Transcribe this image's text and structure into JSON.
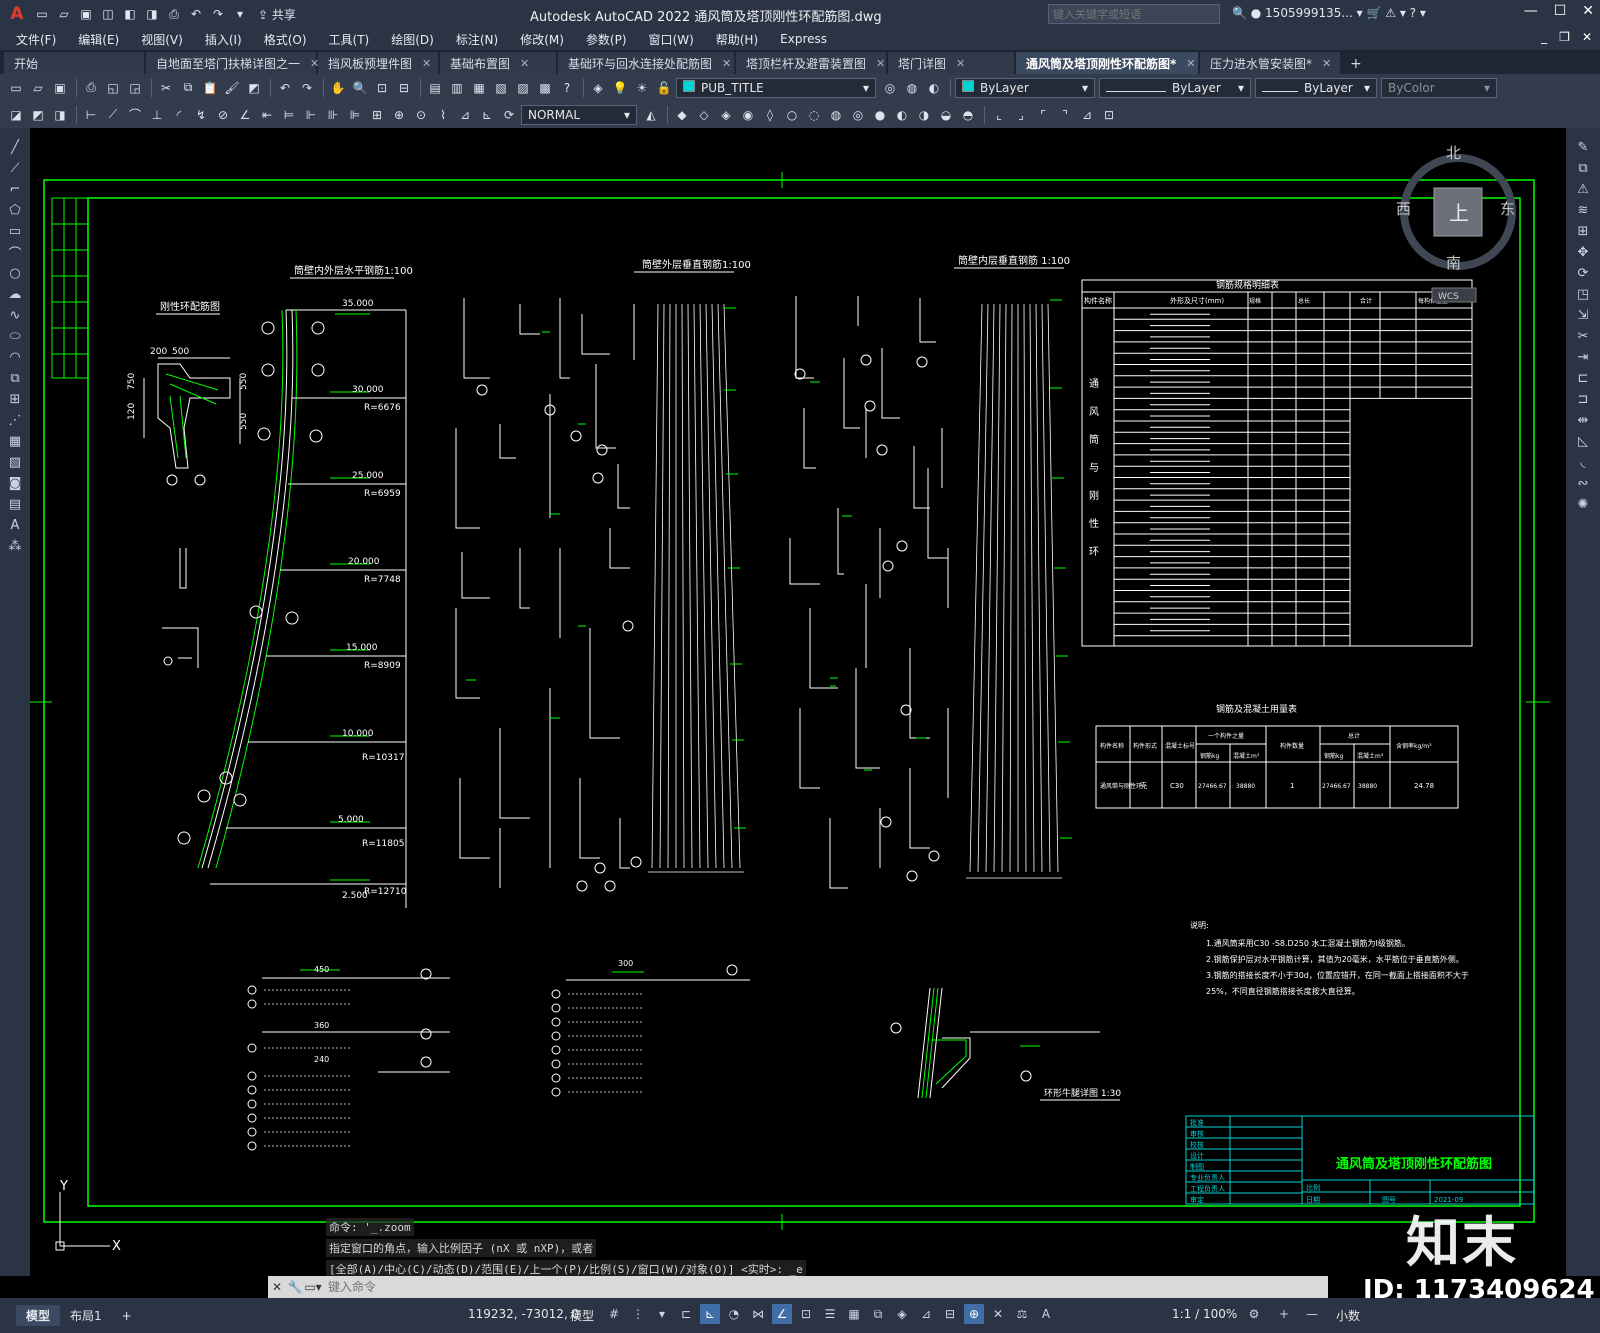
{
  "app": {
    "title": "Autodesk AutoCAD 2022    通风筒及塔顶刚性环配筋图.dwg",
    "share": "共享",
    "search_placeholder": "键入关键字或短语",
    "user": "1505999135...",
    "logo_letter": "A"
  },
  "menu": [
    "文件(F)",
    "编辑(E)",
    "视图(V)",
    "插入(I)",
    "格式(O)",
    "工具(T)",
    "绘图(D)",
    "标注(N)",
    "修改(M)",
    "参数(P)",
    "窗口(W)",
    "帮助(H)",
    "Express"
  ],
  "tabs": [
    {
      "label": "开始",
      "active": false
    },
    {
      "label": "自地面至塔门扶梯详图之一",
      "active": false
    },
    {
      "label": "挡风板预埋件图",
      "active": false
    },
    {
      "label": "基础布置图",
      "active": false
    },
    {
      "label": "基础环与回水连接处配筋图",
      "active": false
    },
    {
      "label": "塔顶栏杆及避雷装置图",
      "active": false
    },
    {
      "label": "塔门详图",
      "active": false
    },
    {
      "label": "通风筒及塔顶刚性环配筋图*",
      "active": true
    },
    {
      "label": "压力进水管安装图*",
      "active": false
    }
  ],
  "toolbar": {
    "layer": "PUB_TITLE",
    "color": "ByLayer",
    "linetype": "ByLayer",
    "lineweight": "ByLayer",
    "plotstyle": "ByColor",
    "textstyle": "NORMAL",
    "layer_color": "#00d5d5",
    "color_swatch": "#00d5d5"
  },
  "viewcube": {
    "north": "北",
    "south": "南",
    "east": "东",
    "west": "西",
    "face": "上",
    "wcs": "WCS"
  },
  "drawing": {
    "title_main": "通风筒及塔顶刚性环配筋图",
    "t_inner_horizontal": "筒壁内外层水平钢筋1:100",
    "t_outer_vertical": "筒壁外层垂直钢筋1:100",
    "t_inner_vertical": "筒壁内层垂直钢筋 1:100",
    "t_rigid_ring": "刚性环配筋图",
    "t_rebar_table": "钢筋规格明细表",
    "t_material_table": "钢筋及混凝土用量表",
    "t_detail": "环形牛腿详图 1:30",
    "notes_title": "说明:",
    "notes": [
      "1.通风筒采用C30 -S8.D250  水工混凝土钢筋为I级钢筋。",
      "2.钢筋保护层对水平钢筋计算，其值为20毫米，水平筋位于垂直筋外侧。",
      "3.钢筋的搭接长度不小于30d，位置应错开，在同一截面上搭接面积不大于",
      "   25%，不同直径钢筋搭接长度按大直径算。"
    ],
    "elevations": [
      "35.000",
      "30.000",
      "25.000",
      "20.000",
      "15.000",
      "10.000",
      "5.000",
      "2.500"
    ],
    "radii": [
      "R=6676",
      "R=6959",
      "R=7748",
      "R=8909",
      "R=10317",
      "R=11805",
      "R=12710"
    ],
    "mat_headers": [
      "构件名称",
      "构件形式",
      "混凝土标号",
      "一个构件之量",
      "构件数量",
      "总计",
      "含钢率kg/m³"
    ],
    "mat_sub": [
      "钢筋kg",
      "混凝土m³",
      "钢筋kg",
      "混凝土m³"
    ],
    "mat_row": [
      "通风筒与刚性环",
      "壳",
      "C30",
      "27466.67",
      "38880",
      "1",
      "27466.67",
      "38880",
      "24.78"
    ],
    "rebar_headers": [
      "构件名称",
      "编号",
      "外形及尺寸(mm)",
      "规格",
      "单根长度",
      "根数",
      "总长",
      "合计",
      "每构件重量"
    ],
    "rebar_side": "通风筒与刚性环",
    "dims": [
      "200",
      "500",
      "750",
      "120",
      "550",
      "550",
      "450",
      "360",
      "240",
      "300"
    ],
    "titleblock_rows": [
      "批准",
      "审核",
      "校核",
      "设计",
      "制图",
      "专业负责人",
      "工程负责人",
      "审定"
    ],
    "tb_scale": "比例",
    "tb_date": "日期",
    "tb_drawno": "图号",
    "tb_year": "2021-09"
  },
  "command": {
    "history": [
      "命令: '_.zoom",
      "指定窗口的角点，输入比例因子 (nX 或 nXP)，或者",
      "[全部(A)/中心(C)/动态(D)/范围(E)/上一个(P)/比例(S)/窗口(W)/对象(O)] <实时>: _e"
    ],
    "placeholder": "键入命令"
  },
  "status": {
    "layout_tabs": [
      "模型",
      "布局1"
    ],
    "coords": "119232, -73012, 0",
    "mode": "模型",
    "scale": "1:1 / 100%",
    "units": "小数"
  },
  "ucs": {
    "y": "Y",
    "x": "X"
  },
  "watermark": {
    "big": "知末",
    "id": "ID: 1173409624"
  }
}
